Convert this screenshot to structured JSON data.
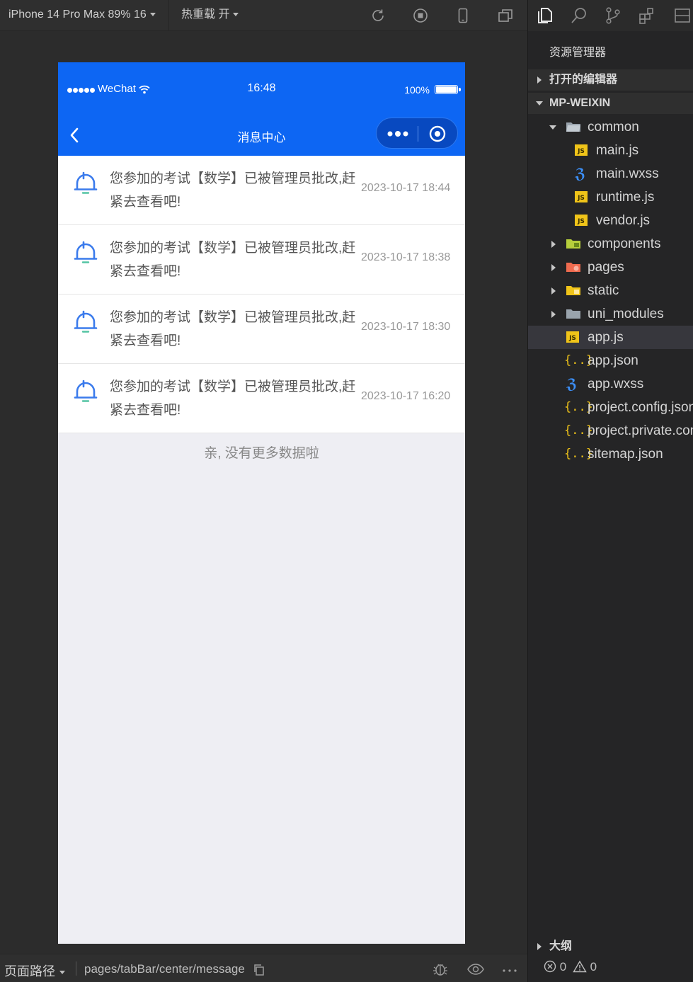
{
  "toolbar": {
    "device_label": "iPhone 14 Pro Max 89% 16",
    "hot_reload_label": "热重载 开"
  },
  "phone": {
    "status_bar": {
      "carrier": "WeChat",
      "time": "16:48",
      "battery": "100%"
    },
    "nav": {
      "title": "消息中心"
    },
    "messages": [
      {
        "text": "您参加的考试【数学】已被管理员批改,赶紧去查看吧!",
        "time": "2023-10-17 18:44"
      },
      {
        "text": "您参加的考试【数学】已被管理员批改,赶紧去查看吧!",
        "time": "2023-10-17 18:38"
      },
      {
        "text": "您参加的考试【数学】已被管理员批改,赶紧去查看吧!",
        "time": "2023-10-17 18:30"
      },
      {
        "text": "您参加的考试【数学】已被管理员批改,赶紧去查看吧!",
        "time": "2023-10-17 16:20"
      }
    ],
    "no_more_text": "亲, 没有更多数据啦"
  },
  "bottom_bar": {
    "path_label": "页面路径",
    "page_path": "pages/tabBar/center/message"
  },
  "explorer": {
    "title": "资源管理器",
    "open_editors_label": "打开的编辑器",
    "project_label": "MP-WEIXIN",
    "tree": {
      "common": "common",
      "main_js": "main.js",
      "main_wxss": "main.wxss",
      "runtime_js": "runtime.js",
      "vendor_js": "vendor.js",
      "components": "components",
      "pages": "pages",
      "static": "static",
      "uni_modules": "uni_modules",
      "app_js": "app.js",
      "app_json": "app.json",
      "app_wxss": "app.wxss",
      "project_config": "project.config.json",
      "project_private": "project.private.config.json",
      "sitemap": "sitemap.json"
    },
    "outline_label": "大纲",
    "errors": "0",
    "warnings": "0"
  },
  "colors": {
    "brand_blue": "#0d66f3",
    "js_icon": "#f0c419",
    "css_icon": "#3c8ff7"
  }
}
